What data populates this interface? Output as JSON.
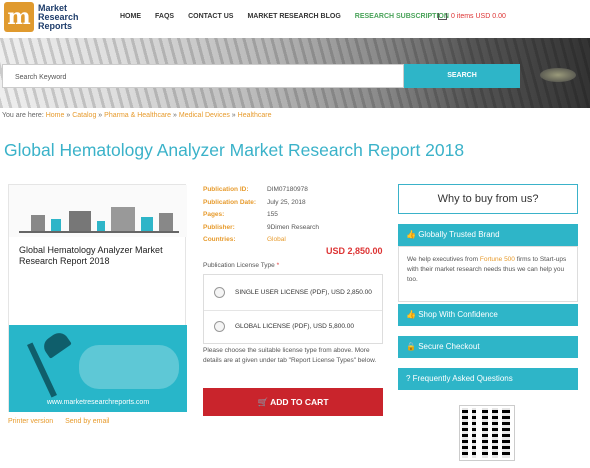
{
  "header": {
    "logo_text": "Market Research Reports",
    "nav": [
      "HOME",
      "FAQS",
      "CONTACT US",
      "MARKET RESEARCH BLOG",
      "RESEARCH SUBSCRIPTION"
    ],
    "cart": "0 items USD 0.00"
  },
  "search": {
    "placeholder": "Search Keyword",
    "button": "SEARCH"
  },
  "breadcrumb": {
    "prefix": "You are here:",
    "items": [
      "Home",
      "Catalog",
      "Pharma & Healthcare",
      "Medical Devices",
      "Healthcare"
    ]
  },
  "page_title": "Global Hematology Analyzer Market Research Report 2018",
  "product": {
    "cover_title": "Global Hematology Analyzer Market Research Report 2018",
    "cover_url": "www.marketresearchreports.com",
    "print_version": "Printer version",
    "send_by_email": "Send by email"
  },
  "meta": [
    {
      "k": "Publication ID:",
      "v": "DIM07180978"
    },
    {
      "k": "Publication Date:",
      "v": "July 25, 2018"
    },
    {
      "k": "Pages:",
      "v": "155"
    },
    {
      "k": "Publisher:",
      "v": "9Dimen Research"
    },
    {
      "k": "Countries:",
      "v": "Global"
    }
  ],
  "price": "USD 2,850.00",
  "license": {
    "label": "Publication License Type",
    "required": "*",
    "options": [
      "SINGLE USER LICENSE (PDF), USD 2,850.00",
      "GLOBAL LICENSE (PDF), USD 5,800.00"
    ]
  },
  "note": "Please choose the suitable license type from above. More details are at given under tab \"Report License Types\" below.",
  "add_to_cart": "ADD TO CART",
  "sidebar": {
    "why": "Why to buy from us?",
    "trusted": "Globally Trusted Brand",
    "trusted_body_a": "We help executives from ",
    "trusted_body_hl": "Fortune 500",
    "trusted_body_b": " firms to Start-ups with their market research needs thus we can help you too.",
    "shop": "Shop With Confidence",
    "secure": "Secure Checkout",
    "faq": "Frequently Asked Questions"
  },
  "colors": {
    "accent": "#2eb5c8",
    "title": "#3ab2c9",
    "orange": "#e79b2d",
    "cart_button": "#c9242c"
  }
}
